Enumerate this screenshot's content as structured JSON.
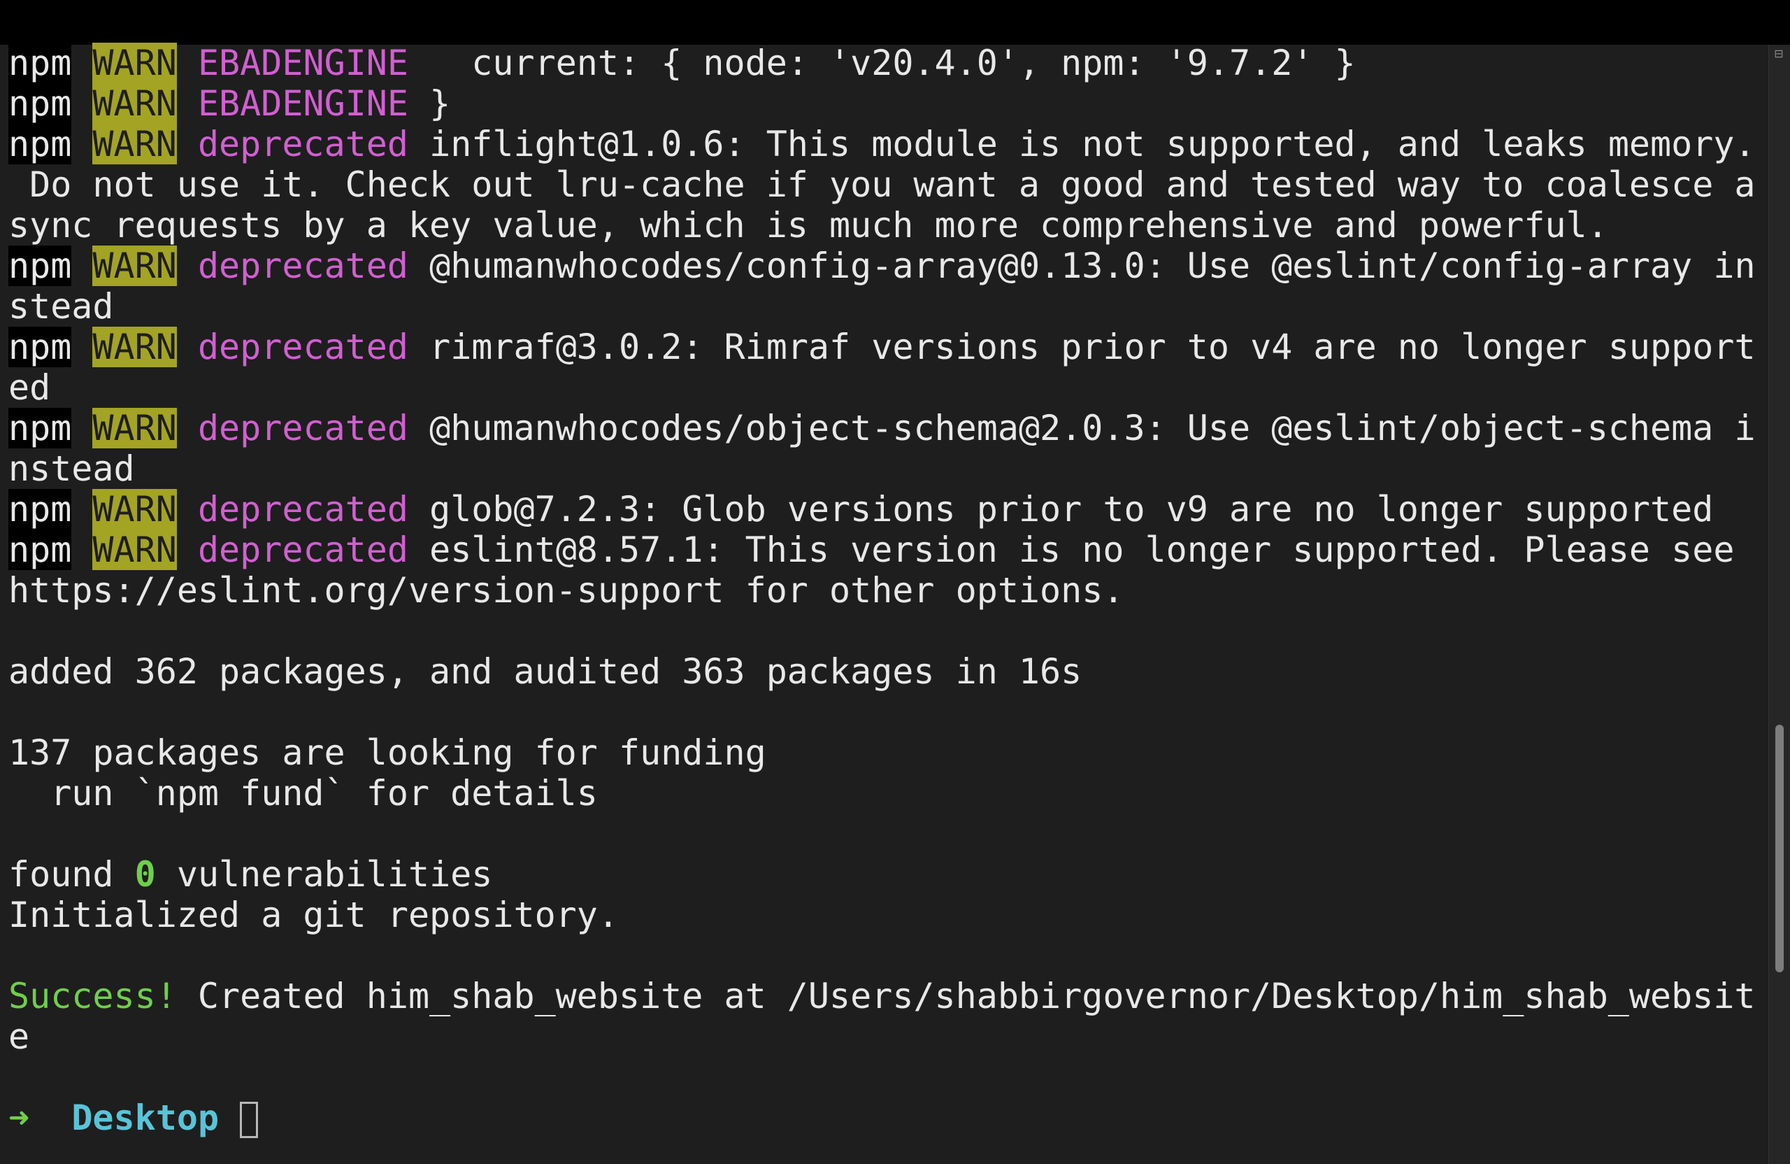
{
  "terminal": {
    "prefix_label": "npm",
    "warn_label": "WARN",
    "lines": [
      {
        "kind": "warn",
        "keyword": "EBADENGINE",
        "text": "   current: { node: 'v20.4.0', npm: '9.7.2' }"
      },
      {
        "kind": "warn",
        "keyword": "EBADENGINE",
        "text": " }"
      },
      {
        "kind": "warn",
        "keyword": "deprecated",
        "text": " inflight@1.0.6: This module is not supported, and leaks memory."
      },
      {
        "kind": "plain",
        "text": " Do not use it. Check out lru-cache if you want a good and tested way to coalesce a"
      },
      {
        "kind": "plain",
        "text": "sync requests by a key value, which is much more comprehensive and powerful."
      },
      {
        "kind": "warn",
        "keyword": "deprecated",
        "text": " @humanwhocodes/config-array@0.13.0: Use @eslint/config-array in"
      },
      {
        "kind": "plain",
        "text": "stead"
      },
      {
        "kind": "warn",
        "keyword": "deprecated",
        "text": " rimraf@3.0.2: Rimraf versions prior to v4 are no longer support"
      },
      {
        "kind": "plain",
        "text": "ed"
      },
      {
        "kind": "warn",
        "keyword": "deprecated",
        "text": " @humanwhocodes/object-schema@2.0.3: Use @eslint/object-schema i"
      },
      {
        "kind": "plain",
        "text": "nstead"
      },
      {
        "kind": "warn",
        "keyword": "deprecated",
        "text": " glob@7.2.3: Glob versions prior to v9 are no longer supported"
      },
      {
        "kind": "warn",
        "keyword": "deprecated",
        "text": " eslint@8.57.1: This version is no longer supported. Please see"
      },
      {
        "kind": "plain",
        "text": "https://eslint.org/version-support for other options."
      },
      {
        "kind": "plain",
        "text": ""
      },
      {
        "kind": "plain",
        "text": "added 362 packages, and audited 363 packages in 16s"
      },
      {
        "kind": "plain",
        "text": ""
      },
      {
        "kind": "plain",
        "text": "137 packages are looking for funding"
      },
      {
        "kind": "plain",
        "text": "  run `npm fund` for details"
      },
      {
        "kind": "plain",
        "text": ""
      },
      {
        "kind": "vuln",
        "before": "found ",
        "count": "0",
        "after": " vulnerabilities"
      },
      {
        "kind": "plain",
        "text": "Initialized a git repository."
      },
      {
        "kind": "plain",
        "text": ""
      },
      {
        "kind": "success",
        "label": "Success!",
        "text": " Created him_shab_website at /Users/shabbirgovernor/Desktop/him_shab_websit"
      },
      {
        "kind": "plain",
        "text": "e"
      },
      {
        "kind": "plain",
        "text": ""
      },
      {
        "kind": "prompt",
        "arrow": "➜",
        "dir": "Desktop"
      }
    ]
  },
  "scrollbar": {
    "icon": "scroll-indicator-icon",
    "position_fraction": 0.78
  },
  "colors": {
    "background": "#1e1e1e",
    "warn_badge": "#a3a324",
    "keyword": "#d25fd2",
    "success": "#6fcf4a",
    "directory": "#58c4d8"
  }
}
